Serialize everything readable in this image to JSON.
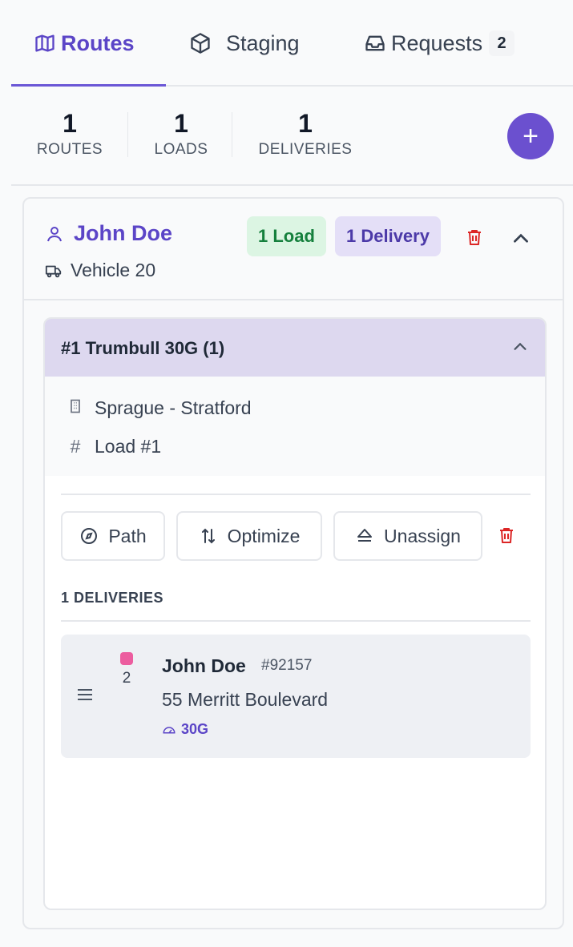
{
  "tabs": [
    {
      "label": "Routes",
      "icon": "map-icon",
      "active": true
    },
    {
      "label": "Staging",
      "icon": "box-icon",
      "active": false
    },
    {
      "label": "Requests",
      "icon": "inbox-icon",
      "active": false,
      "badge": "2"
    }
  ],
  "stats": {
    "routes": {
      "value": "1",
      "label": "ROUTES"
    },
    "loads": {
      "value": "1",
      "label": "LOADS"
    },
    "deliveries": {
      "value": "1",
      "label": "DELIVERIES"
    },
    "add_label": "+"
  },
  "route": {
    "driver": "John Doe",
    "vehicle": "Vehicle 20",
    "load_pill": "1 Load",
    "delivery_pill": "1 Delivery",
    "load": {
      "title": "#1 Trumbull 30G (1)",
      "terminal": "Sprague - Stratford",
      "load_number": "Load #1",
      "actions": {
        "path": "Path",
        "optimize": "Optimize",
        "unassign": "Unassign"
      },
      "deliveries_label": "1 DELIVERIES",
      "deliveries": [
        {
          "sequence": "2",
          "customer": "John Doe",
          "order": "#92157",
          "address": "55 Merritt Boulevard",
          "quantity": "30G",
          "status_color": "#ec5d9f"
        }
      ]
    }
  },
  "colors": {
    "accent": "#5b45c7",
    "accent_button": "#6b50cf",
    "load_pill_bg": "#dcf5e3",
    "delivery_pill_bg": "#e4dff7",
    "danger": "#dc2626"
  }
}
